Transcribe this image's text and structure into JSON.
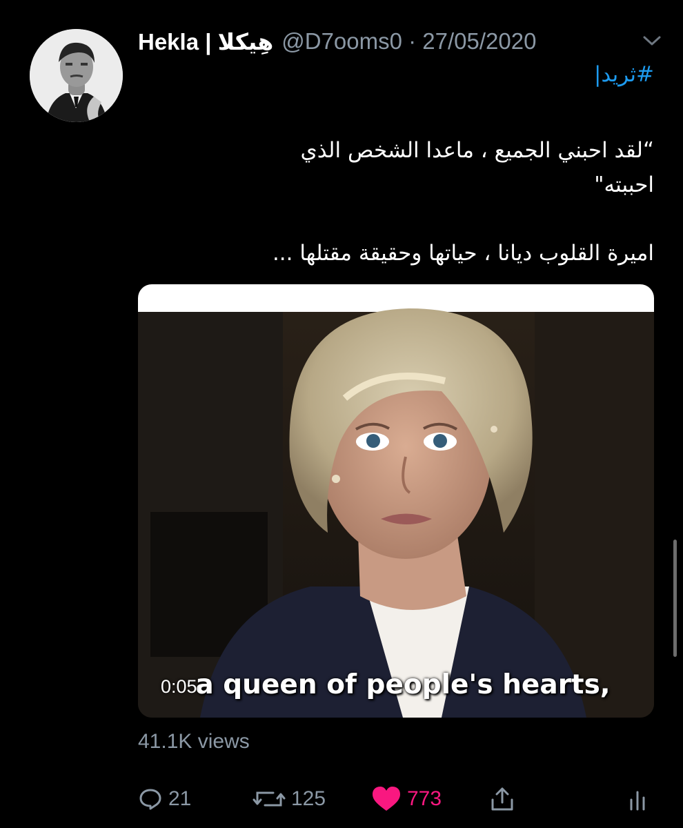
{
  "tweet": {
    "display_name": "Hekla | هِيكلا",
    "handle_date": "@D7ooms0 · 27/05/2020",
    "hashtag": "#ثريد|",
    "quote_line1": "“لقد احبني الجميع ، ماعدا الشخص الذي",
    "quote_line2": "احببته\"",
    "caption": "اميرة القلوب ديانا ، حياتها وحقيقة مقتلها ..."
  },
  "media": {
    "subtitle": "a queen of people's hearts,",
    "timecode": "0:05"
  },
  "stats": {
    "views": "41.1K views",
    "replies": "21",
    "retweets": "125",
    "likes": "773"
  },
  "icons": {
    "more": "chevron-down-icon",
    "reply": "reply-icon",
    "retweet": "retweet-icon",
    "like": "heart-icon",
    "share": "share-icon",
    "analytics": "analytics-icon"
  },
  "colors": {
    "background": "#000000",
    "text": "#ffffff",
    "muted": "#8b98a5",
    "link": "#1d9bf0",
    "like": "#f91880"
  }
}
